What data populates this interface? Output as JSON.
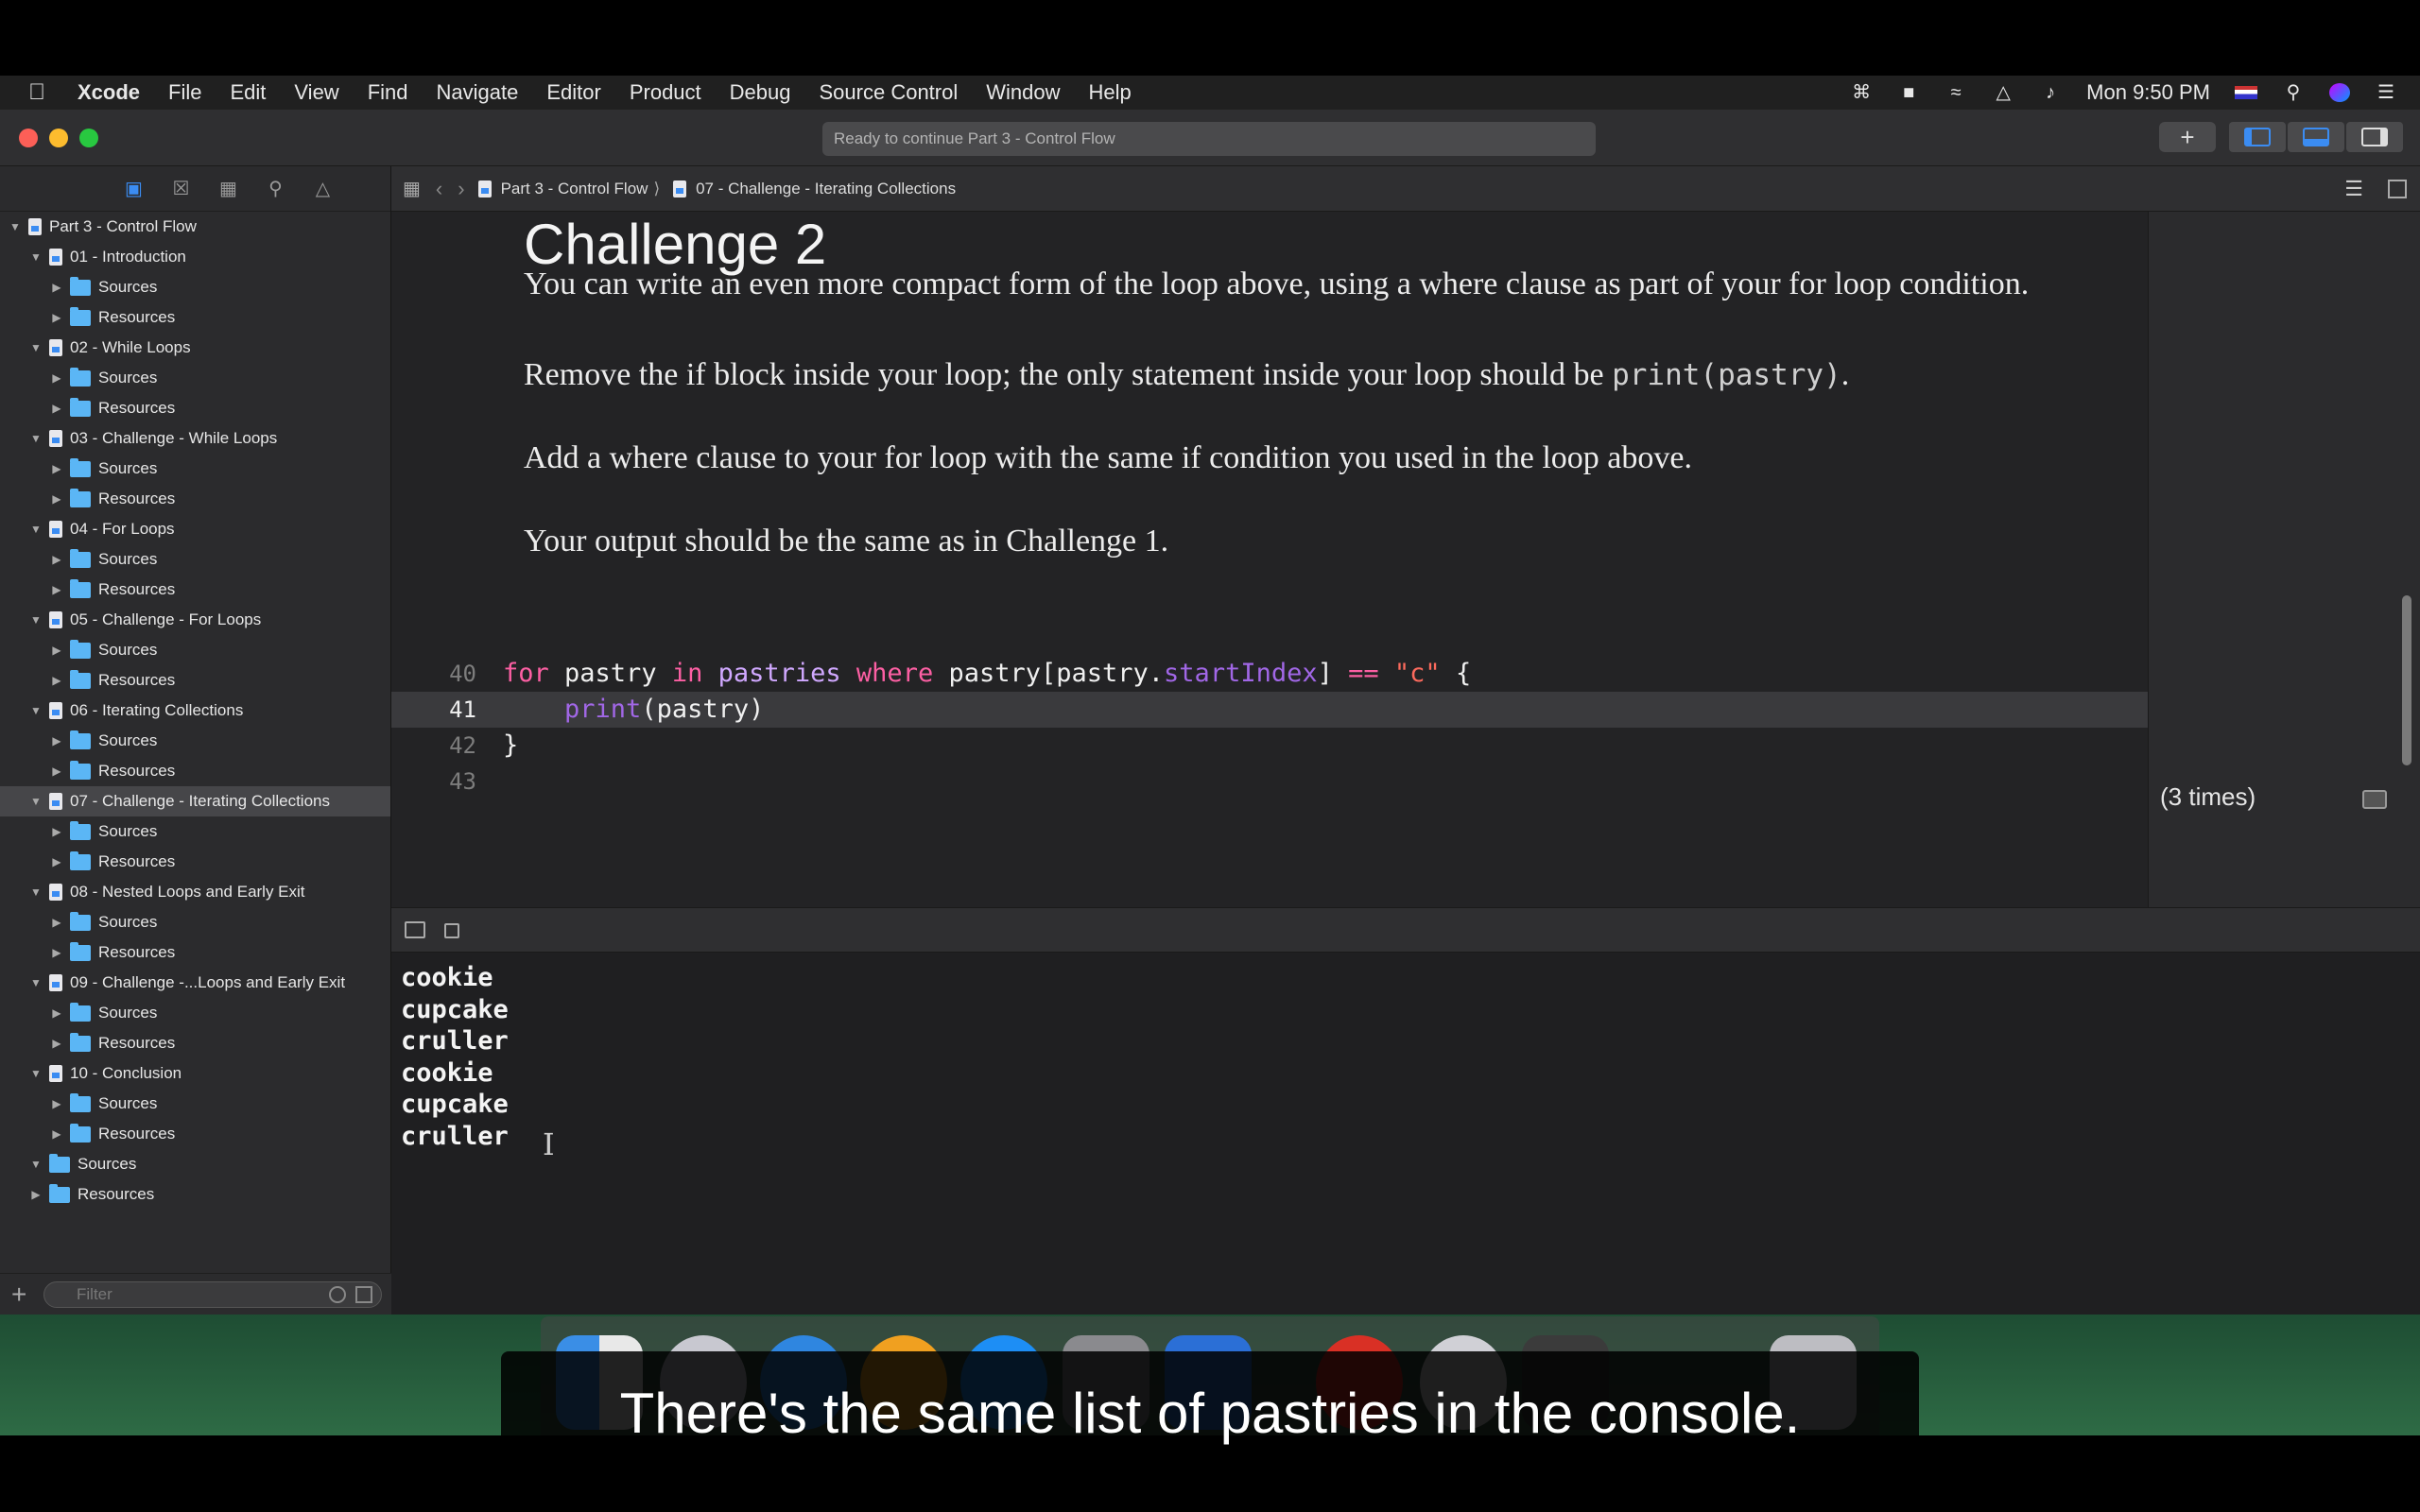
{
  "menubar": {
    "items": [
      "Xcode",
      "File",
      "Edit",
      "View",
      "Find",
      "Navigate",
      "Editor",
      "Product",
      "Debug",
      "Source Control",
      "Window",
      "Help"
    ],
    "clock": "Mon 9:50 PM"
  },
  "toolbar": {
    "activity_text": "Ready to continue Part 3 - Control Flow"
  },
  "jumpbar": {
    "crumbs": [
      "Part 3 - Control Flow",
      "07 - Challenge - Iterating Collections"
    ]
  },
  "navigator": {
    "rows": [
      {
        "label": "Part 3 - Control Flow",
        "kind": "file",
        "level": 0,
        "open": true
      },
      {
        "label": "01 - Introduction",
        "kind": "file",
        "level": 1,
        "open": true
      },
      {
        "label": "Sources",
        "kind": "folder",
        "level": 2
      },
      {
        "label": "Resources",
        "kind": "folder",
        "level": 2
      },
      {
        "label": "02 - While Loops",
        "kind": "file",
        "level": 1,
        "open": true
      },
      {
        "label": "Sources",
        "kind": "folder",
        "level": 2
      },
      {
        "label": "Resources",
        "kind": "folder",
        "level": 2
      },
      {
        "label": "03 - Challenge - While Loops",
        "kind": "file",
        "level": 1,
        "open": true
      },
      {
        "label": "Sources",
        "kind": "folder",
        "level": 2
      },
      {
        "label": "Resources",
        "kind": "folder",
        "level": 2
      },
      {
        "label": "04 - For Loops",
        "kind": "file",
        "level": 1,
        "open": true
      },
      {
        "label": "Sources",
        "kind": "folder",
        "level": 2
      },
      {
        "label": "Resources",
        "kind": "folder",
        "level": 2
      },
      {
        "label": "05 - Challenge - For Loops",
        "kind": "file",
        "level": 1,
        "open": true
      },
      {
        "label": "Sources",
        "kind": "folder",
        "level": 2
      },
      {
        "label": "Resources",
        "kind": "folder",
        "level": 2
      },
      {
        "label": "06 - Iterating Collections",
        "kind": "file",
        "level": 1,
        "open": true
      },
      {
        "label": "Sources",
        "kind": "folder",
        "level": 2
      },
      {
        "label": "Resources",
        "kind": "folder",
        "level": 2
      },
      {
        "label": "07 - Challenge - Iterating Collections",
        "kind": "file",
        "level": 1,
        "open": true,
        "selected": true
      },
      {
        "label": "Sources",
        "kind": "folder",
        "level": 2
      },
      {
        "label": "Resources",
        "kind": "folder",
        "level": 2
      },
      {
        "label": "08 - Nested Loops and Early Exit",
        "kind": "file",
        "level": 1,
        "open": true
      },
      {
        "label": "Sources",
        "kind": "folder",
        "level": 2
      },
      {
        "label": "Resources",
        "kind": "folder",
        "level": 2
      },
      {
        "label": "09 - Challenge -...Loops and Early Exit",
        "kind": "file",
        "level": 1,
        "open": true
      },
      {
        "label": "Sources",
        "kind": "folder",
        "level": 2
      },
      {
        "label": "Resources",
        "kind": "folder",
        "level": 2
      },
      {
        "label": "10 - Conclusion",
        "kind": "file",
        "level": 1,
        "open": true
      },
      {
        "label": "Sources",
        "kind": "folder",
        "level": 2
      },
      {
        "label": "Resources",
        "kind": "folder",
        "level": 2
      },
      {
        "label": "Sources",
        "kind": "folder",
        "level": 1,
        "open": true
      },
      {
        "label": "Resources",
        "kind": "folder",
        "level": 1
      }
    ],
    "filter_placeholder": "Filter"
  },
  "editor": {
    "doc_title": "Challenge 2",
    "para1": "You can write an even more compact form of the loop above, using a where clause as part of your for loop condition.",
    "para2_text": "Remove the if block inside your loop; the only statement inside your loop should be ",
    "para2_code": "print(pastry)",
    "para2_end": ".",
    "para3": "Add a where clause to your for loop with the same if condition you used in the loop above.",
    "para4": "Your output should be the same as in Challenge 1.",
    "code_lines": [
      {
        "number": "40",
        "tokens": [
          {
            "t": "for",
            "c": "kw"
          },
          {
            "t": " pastry ",
            "c": ""
          },
          {
            "t": "in",
            "c": "kw"
          },
          {
            "t": " ",
            "c": ""
          },
          {
            "t": "pastries",
            "c": "ty"
          },
          {
            "t": " ",
            "c": ""
          },
          {
            "t": "where",
            "c": "kw"
          },
          {
            "t": " pastry[pastry.",
            "c": ""
          },
          {
            "t": "startIndex",
            "c": "pr"
          },
          {
            "t": "] ",
            "c": ""
          },
          {
            "t": "==",
            "c": "kw"
          },
          {
            "t": " ",
            "c": ""
          },
          {
            "t": "\"c\"",
            "c": "st"
          },
          {
            "t": " {",
            "c": ""
          }
        ]
      },
      {
        "number": "41",
        "current": true,
        "tokens": [
          {
            "t": "    ",
            "c": ""
          },
          {
            "t": "print",
            "c": "fn"
          },
          {
            "t": "(pastry)",
            "c": ""
          }
        ]
      },
      {
        "number": "42",
        "tokens": [
          {
            "t": "}",
            "c": ""
          }
        ]
      },
      {
        "number": "43",
        "tokens": []
      }
    ]
  },
  "results": {
    "line41": "(3 times)"
  },
  "console": {
    "lines": [
      "cookie",
      "cupcake",
      "cruller",
      "cookie",
      "cupcake",
      "cruller"
    ]
  },
  "subtitle": "There's the same list of pastries in the console."
}
